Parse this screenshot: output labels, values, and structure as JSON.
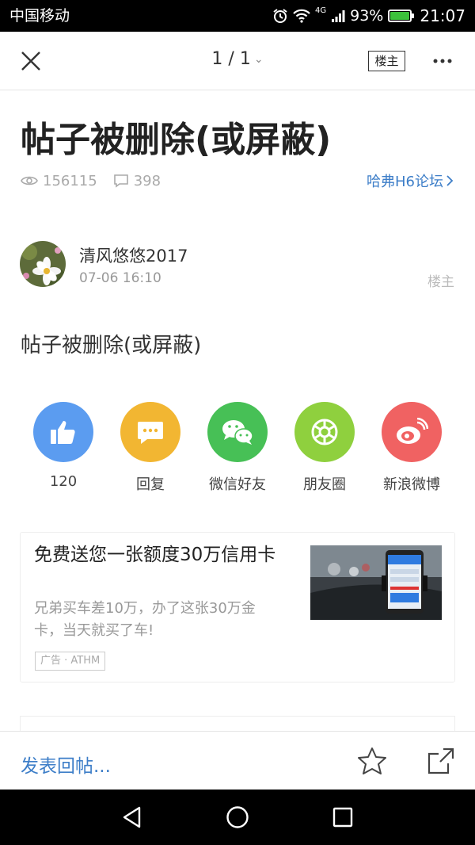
{
  "status_bar": {
    "carrier": "中国移动",
    "network": "4G",
    "battery": "93%",
    "time": "21:07"
  },
  "nav": {
    "page_indicator": "1 / 1",
    "op_only_label": "楼主"
  },
  "post": {
    "title": "帖子被删除(或屏蔽)",
    "views": "156115",
    "replies": "398",
    "forum": "哈弗H6论坛",
    "author": "清风悠悠2017",
    "time": "07-06 16:10",
    "floor_label": "楼主",
    "content": "帖子被删除(或屏蔽)"
  },
  "share": {
    "items": [
      {
        "label": "120",
        "icon": "thumbs-up-icon",
        "color": "#5b9cf0"
      },
      {
        "label": "回复",
        "icon": "chat-bubble-icon",
        "color": "#f2b632"
      },
      {
        "label": "微信好友",
        "icon": "wechat-icon",
        "color": "#47c056"
      },
      {
        "label": "朋友圈",
        "icon": "moments-icon",
        "color": "#8fd03e"
      },
      {
        "label": "新浪微博",
        "icon": "weibo-icon",
        "color": "#f06262"
      }
    ]
  },
  "ad": {
    "title": "免费送您一张额度30万信用卡",
    "description": "兄弟买车差10万，办了这张30万金卡，当天就买了车!",
    "badge": "广告 · ATHM"
  },
  "bottom_bar": {
    "reply_placeholder": "发表回帖..."
  },
  "colors": {
    "link": "#3d7ec8",
    "title": "#222222"
  }
}
